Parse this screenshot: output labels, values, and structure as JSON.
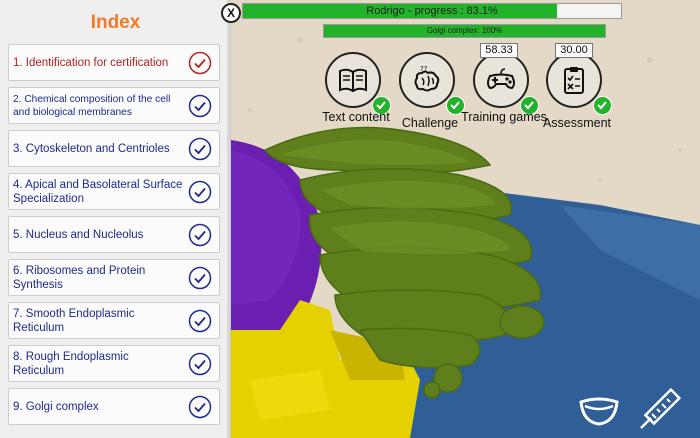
{
  "index": {
    "title": "Index",
    "items": [
      {
        "label": "1. Identification for certification",
        "active": true
      },
      {
        "label": "2. Chemical composition of the cell and biological membranes",
        "small": true
      },
      {
        "label": "3. Cytoskeleton and Centrioles"
      },
      {
        "label": "4. Apical and Basolateral Surface Specialization"
      },
      {
        "label": "5. Nucleus and Nucleolus"
      },
      {
        "label": "6. Ribosomes and Protein Synthesis"
      },
      {
        "label": "7. Smooth Endoplasmic Reticulum"
      },
      {
        "label": "8. Rough Endoplasmic Reticulum"
      },
      {
        "label": "9. Golgi complex"
      }
    ]
  },
  "close_label": "X",
  "progress": {
    "main_text": "Rodrigo - progress : 83.1%",
    "main_value": 83.1,
    "sub_text": "Golgi complex: 100%",
    "sub_value": 100
  },
  "activities": [
    {
      "label": "Text content",
      "icon": "book-icon"
    },
    {
      "label": "Challenge",
      "icon": "brain-icon"
    },
    {
      "label": "Training games",
      "icon": "gamepad-icon",
      "score": "58.33"
    },
    {
      "label": "Assessment",
      "icon": "clipboard-icon",
      "score": "30.00"
    }
  ],
  "colors": {
    "accent": "#f07a28",
    "progress_green": "#22b32a",
    "item_text": "#1e2a8a",
    "active_item_text": "#b1241f"
  },
  "tools": [
    "slice-tool-icon",
    "ruler-tool-icon"
  ]
}
